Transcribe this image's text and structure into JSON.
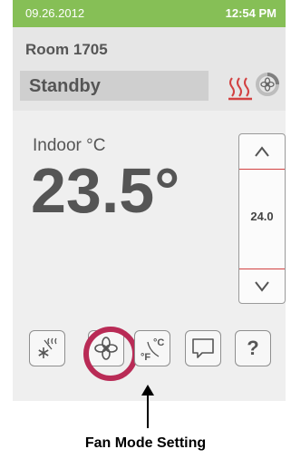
{
  "status": {
    "date": "09.26.2012",
    "time": "12:54 PM"
  },
  "room": {
    "name": "Room 1705",
    "mode": "Standby"
  },
  "indoor": {
    "label": "Indoor °C",
    "temperature": "23.5°"
  },
  "setpoint": {
    "value": "24.0"
  },
  "icons": {
    "heat": "heat-icon",
    "fan_status": "fan-status-icon",
    "snowflake_heat": "snowflake-heat-icon",
    "fan_mode": "fan-icon",
    "units": "units-toggle-icon",
    "message": "message-icon",
    "help": "help-icon"
  },
  "buttons": {
    "help_label": "?"
  },
  "colors": {
    "status_bar": "#86bf56",
    "heat_red": "#d24141",
    "highlight_ring": "#b92b56"
  },
  "caption": "Fan Mode Setting"
}
